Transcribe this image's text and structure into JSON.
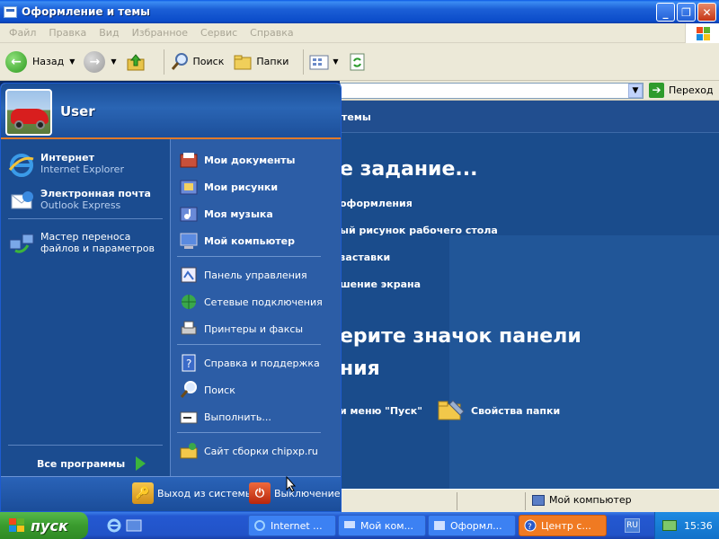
{
  "window": {
    "title": "Оформление и темы",
    "menu": [
      "Файл",
      "Правка",
      "Вид",
      "Избранное",
      "Сервис",
      "Справка"
    ],
    "toolbar": {
      "back": "Назад",
      "search": "Поиск",
      "folders": "Папки"
    },
    "address": {
      "go": "Переход"
    },
    "content": {
      "crumb": "темы",
      "heading1": "е задание...",
      "tasks": [
        "оформления",
        "ый рисунок рабочего стола",
        "заставки",
        "шение экрана"
      ],
      "heading2a": "ерите значок панели",
      "heading2b": "ния",
      "icon1": "и меню \"Пуск\"",
      "icon2": "Свойства папки"
    },
    "status": {
      "computer": "Мой компьютер"
    }
  },
  "startmenu": {
    "user": "User",
    "left": [
      {
        "title": "Интернет",
        "sub": "Internet Explorer",
        "icon": "ie-icon"
      },
      {
        "title": "Электронная почта",
        "sub": "Outlook Express",
        "icon": "outlook-icon"
      },
      {
        "title": "Мастер переноса файлов и параметров",
        "icon": "transfer-wizard-icon"
      }
    ],
    "all_programs": "Все программы",
    "right": [
      {
        "label": "Мои документы",
        "bold": true,
        "icon": "my-documents-icon"
      },
      {
        "label": "Мои рисунки",
        "bold": true,
        "icon": "my-pictures-icon"
      },
      {
        "label": "Моя музыка",
        "bold": true,
        "icon": "my-music-icon"
      },
      {
        "label": "Мой компьютер",
        "bold": true,
        "icon": "my-computer-icon"
      },
      {
        "label": "Панель управления",
        "icon": "control-panel-icon"
      },
      {
        "label": "Сетевые подключения",
        "icon": "network-icon"
      },
      {
        "label": "Принтеры и факсы",
        "icon": "printer-icon"
      },
      {
        "label": "Справка и поддержка",
        "icon": "help-icon"
      },
      {
        "label": "Поиск",
        "icon": "search-icon"
      },
      {
        "label": "Выполнить...",
        "icon": "run-icon"
      },
      {
        "label": "Сайт сборки chipxp.ru",
        "icon": "website-icon"
      }
    ],
    "logoff": "Выход из системы",
    "shutdown": "Выключение"
  },
  "taskbar": {
    "start": "пуск",
    "tasks": [
      {
        "label": "Internet ...",
        "active": false
      },
      {
        "label": "Мой ком...",
        "active": false
      },
      {
        "label": "Оформл...",
        "active": false
      },
      {
        "label": "Центр с...",
        "active": true
      }
    ],
    "lang": "RU",
    "time": "15:36"
  },
  "colors": {
    "taskbar": "#2458d1",
    "start": "#3a9b2e",
    "accent_orange": "#e07a2a"
  }
}
